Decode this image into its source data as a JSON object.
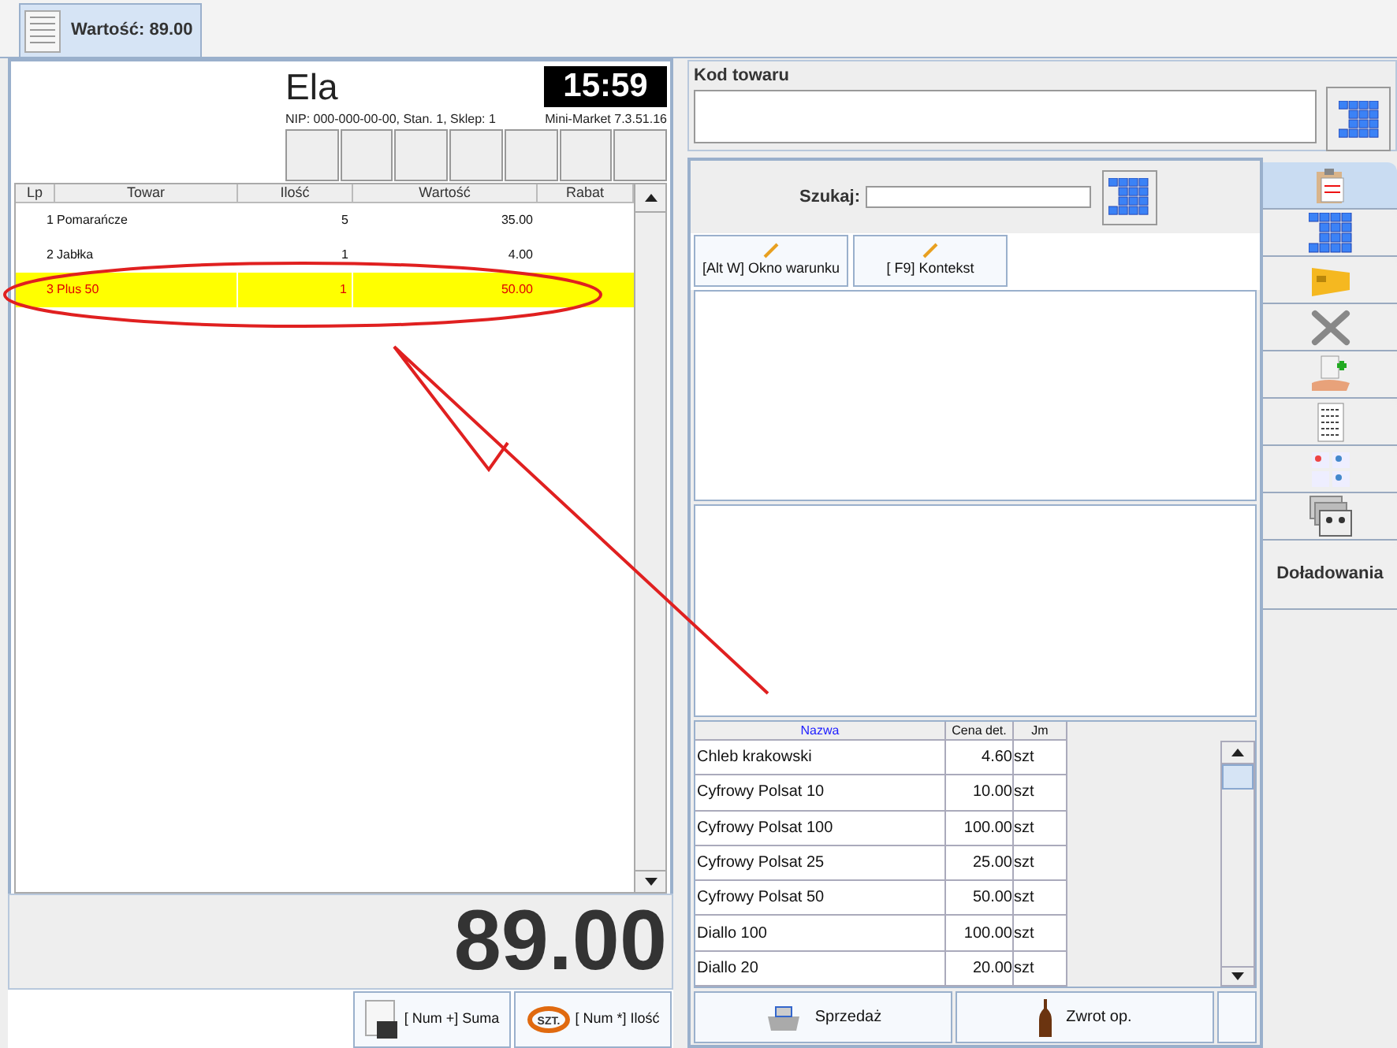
{
  "tab": {
    "label": "Wartość: 89.00",
    "selected": true
  },
  "cashier": "Ela",
  "clock": "15:59",
  "info": "NIP: 000-000-00-00, Stan. 1, Sklep: 1",
  "version": "Mini-Market 7.3.51.16",
  "receipt": {
    "columns": [
      "Lp",
      "Towar",
      "Ilość",
      "Wartość",
      "Rabat"
    ],
    "rows": [
      {
        "lp": "1",
        "name": "Pomarańcze",
        "qty": "5",
        "value": "35.00",
        "selected": false
      },
      {
        "lp": "2",
        "name": "Jabłka",
        "qty": "1",
        "value": "4.00",
        "selected": false
      },
      {
        "lp": "3",
        "name": "Plus 50",
        "qty": "1",
        "value": "50.00",
        "selected": true
      }
    ]
  },
  "total": "89.00",
  "left_buttons": [
    {
      "kind": "sum",
      "label": "[ Num +] Suma"
    },
    {
      "kind": "qty",
      "label": "[ Num *] Ilość",
      "icon_label": "SZT."
    }
  ],
  "code_section": {
    "title": "Kod towaru"
  },
  "search": {
    "label": "Szukaj:"
  },
  "filter_buttons": [
    "[Alt W] Okno warunku",
    "[ F9] Kontekst"
  ],
  "products": {
    "columns": [
      "Nazwa",
      "Cena det.",
      "Jm"
    ],
    "rows": [
      [
        "Chleb krakowski",
        "4.60",
        "szt"
      ],
      [
        "Cyfrowy Polsat 10",
        "10.00",
        "szt"
      ],
      [
        "Cyfrowy Polsat 100",
        "100.00",
        "szt"
      ],
      [
        "Cyfrowy Polsat 25",
        "25.00",
        "szt"
      ],
      [
        "Cyfrowy Polsat 50",
        "50.00",
        "szt"
      ],
      [
        "Diallo 100",
        "100.00",
        "szt"
      ],
      [
        "Diallo 20",
        "20.00",
        "szt"
      ]
    ]
  },
  "bottom_buttons": [
    {
      "kind": "sale",
      "label": "Sprzedaż"
    },
    {
      "kind": "return",
      "label": "Zwrot op."
    }
  ],
  "side_tabs": [
    {
      "kind": "clipboard",
      "selected": true
    },
    {
      "kind": "keypad",
      "selected": false
    },
    {
      "kind": "card",
      "selected": false
    },
    {
      "kind": "tools",
      "selected": false
    },
    {
      "kind": "hand",
      "selected": false
    },
    {
      "kind": "list",
      "selected": false
    },
    {
      "kind": "forms",
      "selected": false
    },
    {
      "kind": "people",
      "selected": false
    },
    {
      "kind": "text",
      "label": "Doładowania",
      "selected": false
    }
  ]
}
